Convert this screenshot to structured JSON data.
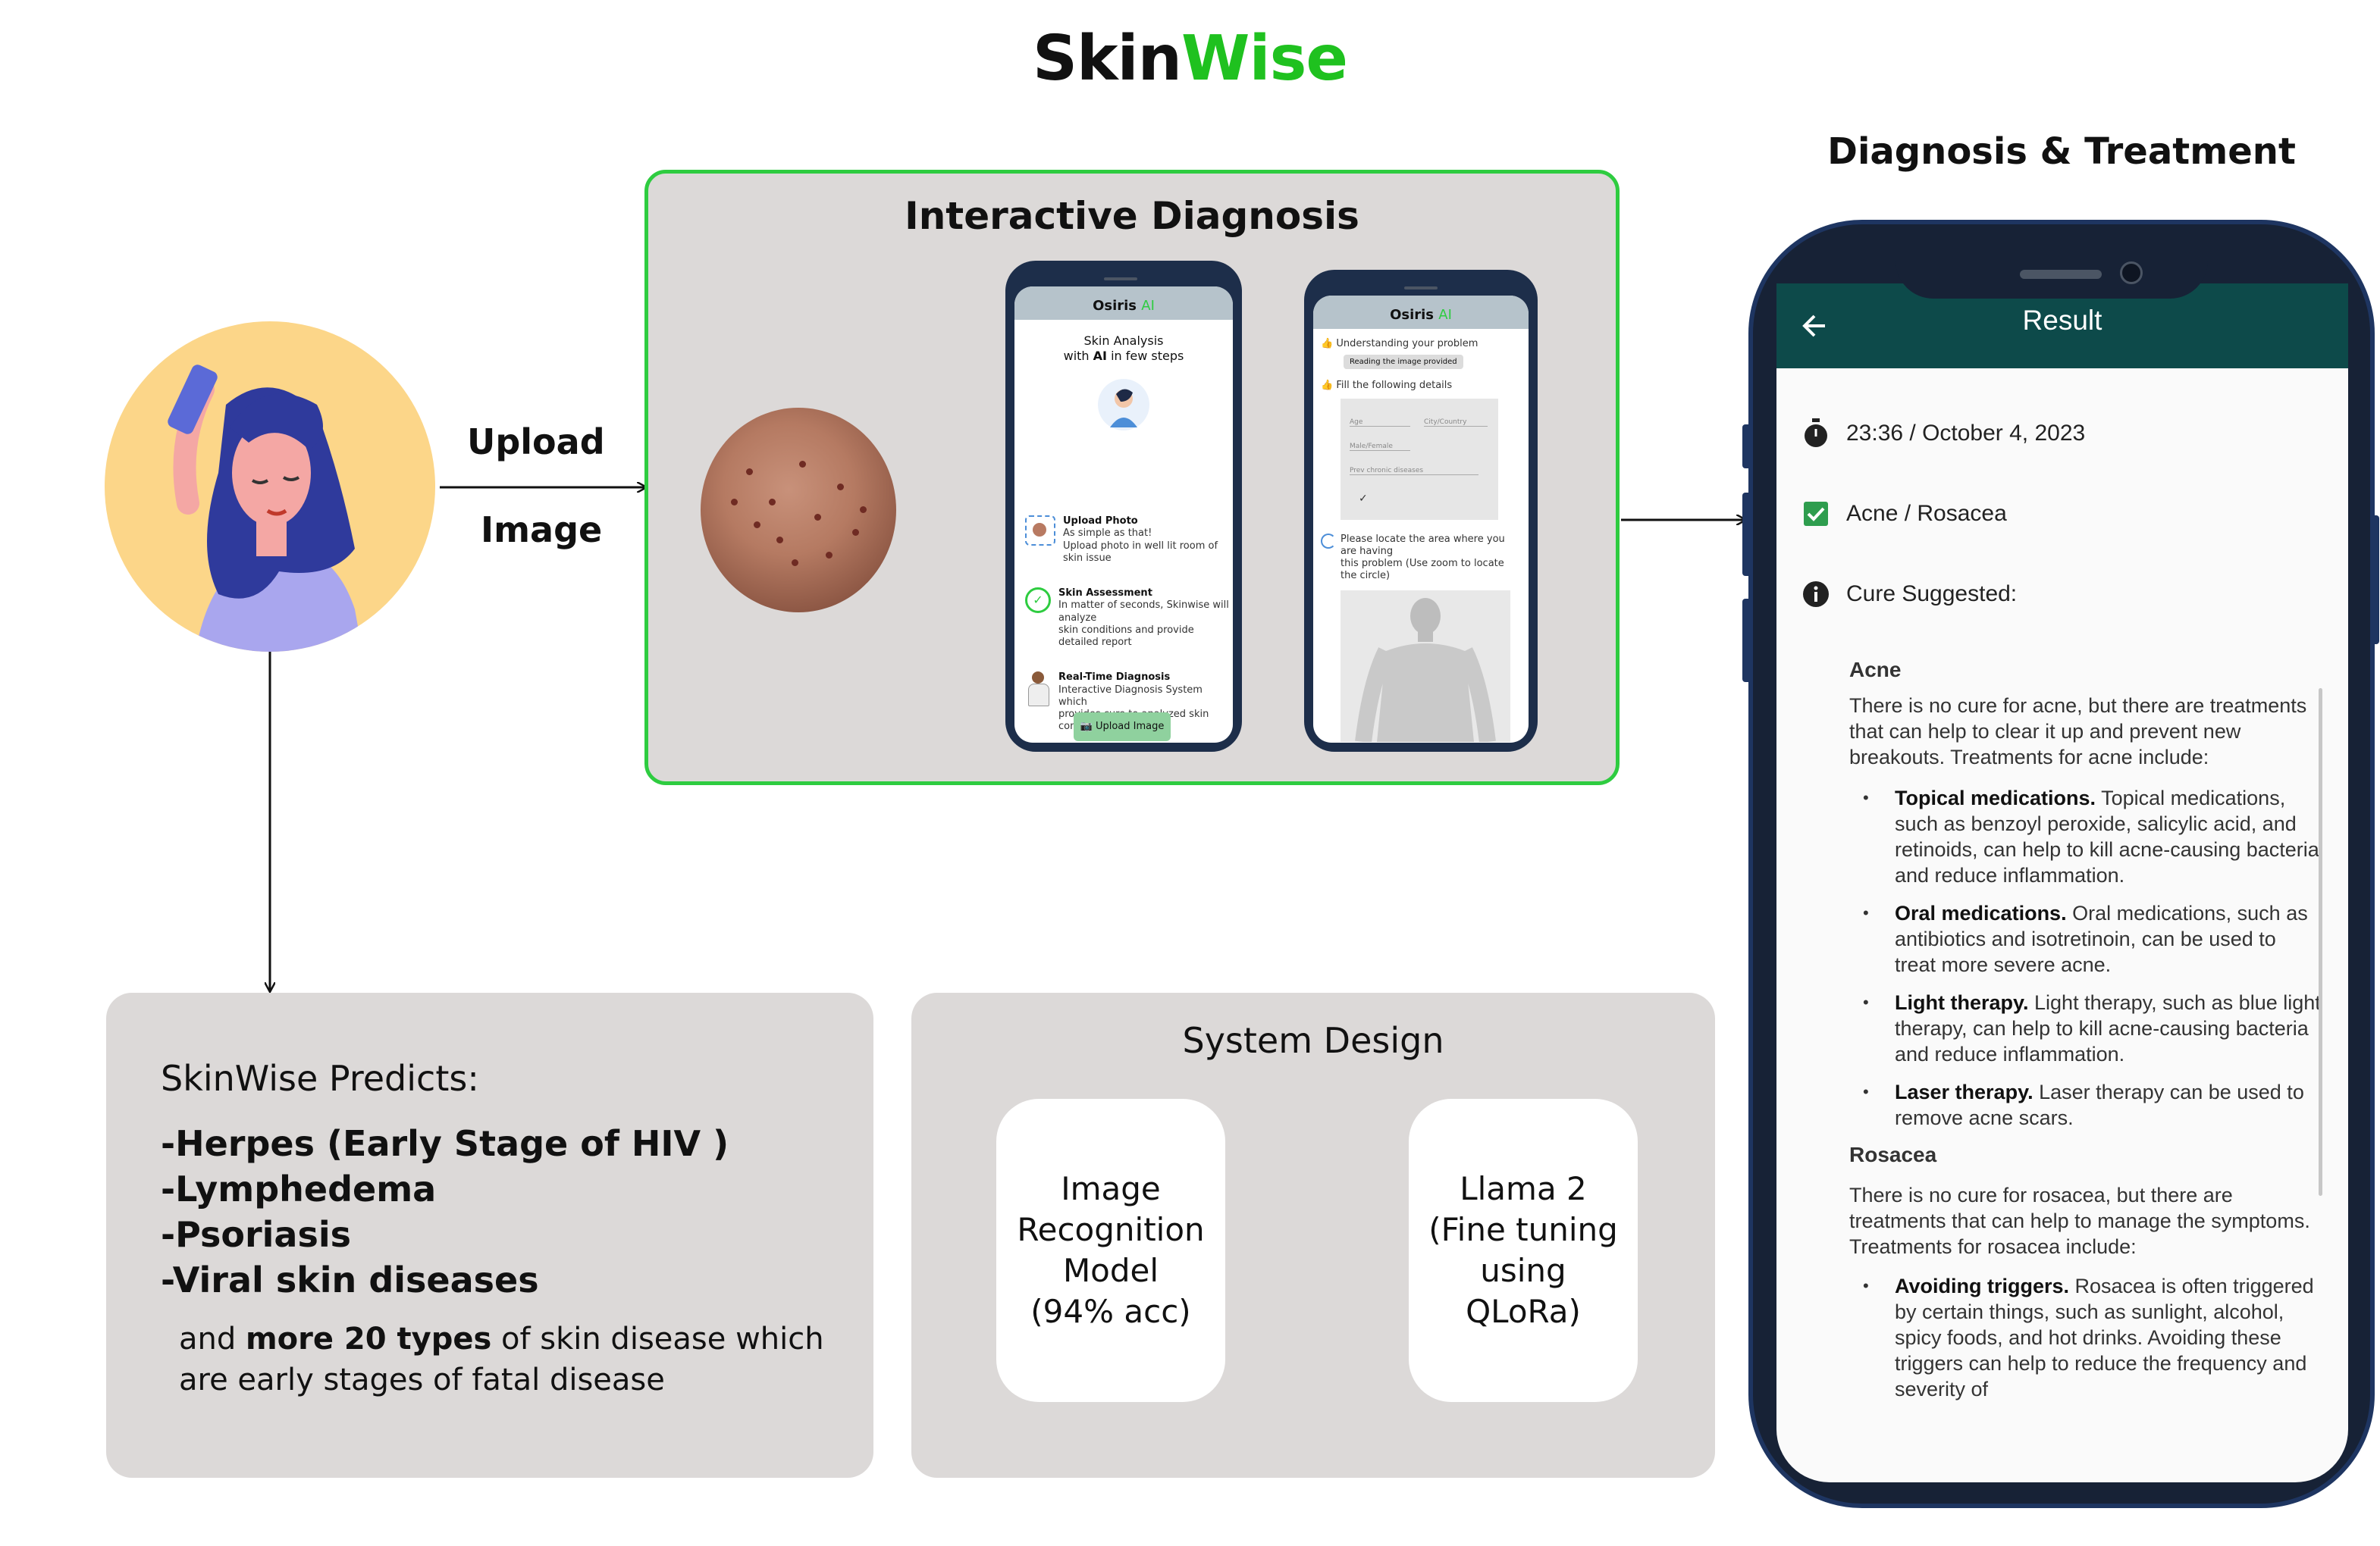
{
  "title": {
    "part1": "Skin",
    "part2": "Wise"
  },
  "upload": {
    "line1": "Upload",
    "line2": "Image"
  },
  "interactive": {
    "title": "Interactive Diagnosis",
    "phone1": {
      "brand": "Osiris",
      "brand_ai": "AI",
      "headline1": "Skin Analysis",
      "headline2_pre": "with ",
      "headline2_ai": "AI",
      "headline2_post": " in few steps",
      "steps": [
        {
          "title": "Upload Photo",
          "desc1": "As simple as that!",
          "desc2": "Upload photo in well lit room of skin issue"
        },
        {
          "title": "Skin Assessment",
          "desc1": "In matter of seconds, Skinwise will analyze",
          "desc2": "skin conditions and provide detailed report"
        },
        {
          "title": "Real-Time Diagnosis",
          "desc1": "Interactive Diagnosis System which",
          "desc2": "provides cure to analyzed skin conditions."
        }
      ],
      "button": "Upload Image"
    },
    "phone2": {
      "brand": "Osiris",
      "brand_ai": "AI",
      "understanding": "Understanding your problem",
      "reading": "Reading the image provided",
      "fill": "Fill the following details",
      "age": "Age",
      "city": "City/Country",
      "gender": "Male/Female",
      "prev": "Prev chronic diseases",
      "locate1": "Please locate the area where you are having",
      "locate2": "this problem (Use zoom to locate the circle)"
    }
  },
  "diagnosis": {
    "title": "Diagnosis & Treatment",
    "screen_title": "Result",
    "timestamp": "23:36 / October 4, 2023",
    "condition": "Acne / Rosacea",
    "cure_label": "Cure Suggested:",
    "acne": {
      "heading": "Acne",
      "intro": "There is no cure for acne, but there are treatments that can help to clear it up and prevent new breakouts. Treatments for acne include:",
      "items": [
        {
          "bold": "Topical medications.",
          "text": " Topical medications, such as benzoyl peroxide, salicylic acid, and retinoids, can help to kill acne-causing bacteria and reduce inflammation."
        },
        {
          "bold": "Oral medications.",
          "text": " Oral medications, such as antibiotics and isotretinoin, can be used to treat more severe acne."
        },
        {
          "bold": "Light therapy.",
          "text": " Light therapy, such as blue light therapy, can help to kill acne-causing bacteria and reduce inflammation."
        },
        {
          "bold": "Laser therapy.",
          "text": " Laser therapy can be used to remove acne scars."
        }
      ]
    },
    "rosacea": {
      "heading": "Rosacea",
      "intro": "There is no cure for rosacea, but there are treatments that can help to manage the symptoms. Treatments for rosacea include:",
      "items": [
        {
          "bold": "Avoiding triggers.",
          "text": " Rosacea is often triggered by certain things, such as sunlight, alcohol, spicy foods, and hot drinks. Avoiding these triggers can help to reduce the frequency and severity of"
        }
      ]
    }
  },
  "predicts": {
    "title": "SkinWise Predicts:",
    "items": [
      "-Herpes (Early Stage of HIV )",
      "-Lymphedema",
      "-Psoriasis",
      "-Viral skin diseases"
    ],
    "note_pre": "and ",
    "note_bold": "more 20 types",
    "note_post": " of skin disease which are early stages of fatal disease"
  },
  "system": {
    "title": "System Design",
    "box1": [
      "Image",
      "Recognition",
      "Model",
      "(94% acc)"
    ],
    "box2": [
      "Llama 2",
      "(Fine tuning",
      "using",
      "QLoRa)"
    ]
  },
  "colors": {
    "brand_green": "#1fc11f",
    "panel_grey": "#dcd9d8",
    "result_bar": "#0d4a4a",
    "phone_frame": "#172236",
    "check_green": "#2e9d4e"
  }
}
